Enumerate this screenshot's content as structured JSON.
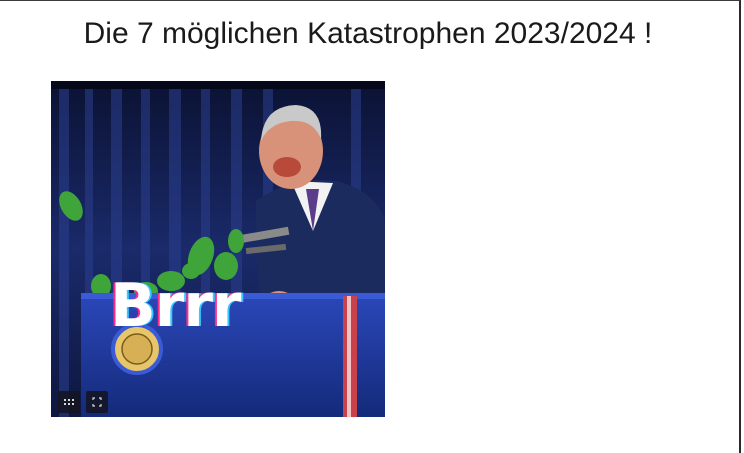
{
  "page": {
    "title": "Die 7 möglichen Katastrophen 2023/2024 !"
  },
  "media": {
    "caption": "Brrr",
    "controls": [
      {
        "icon": "grid-icon"
      },
      {
        "icon": "fullscreen-icon"
      }
    ]
  },
  "colors": {
    "background": "#ffffff",
    "curtain": "#1b2a6b",
    "podium": "#1f3a9a",
    "money": "#3fa53a"
  }
}
